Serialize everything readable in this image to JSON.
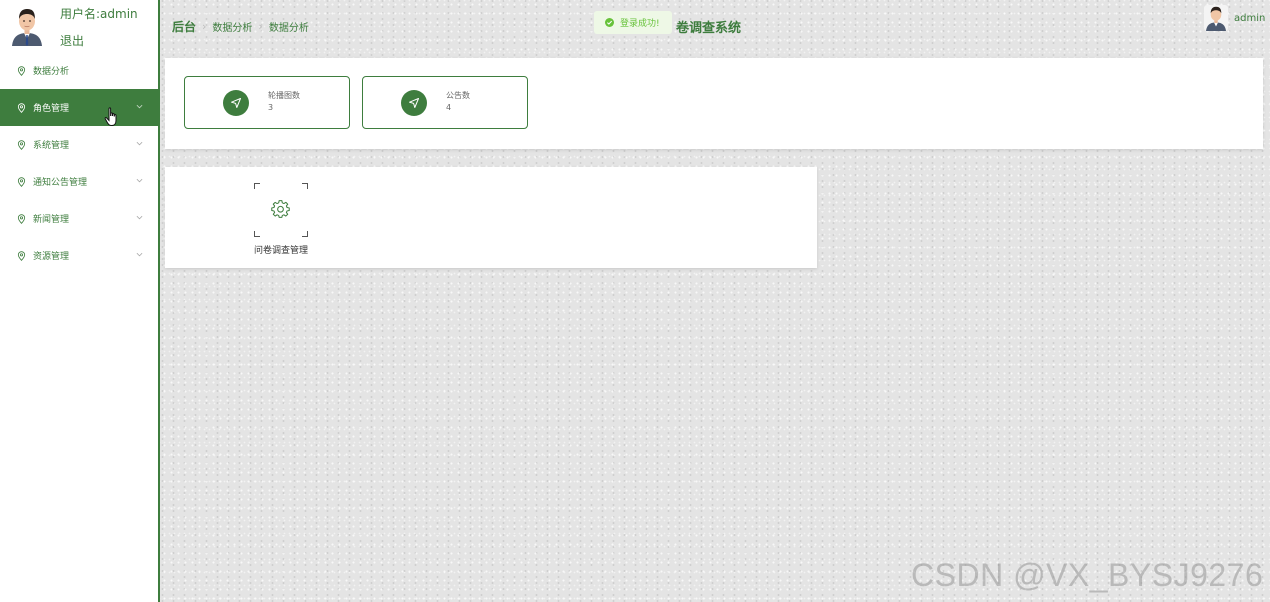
{
  "sidebar": {
    "user_label": "用户名:admin",
    "logout_label": "退出",
    "items": [
      {
        "label": "数据分析",
        "has_submenu": false,
        "active": false
      },
      {
        "label": "角色管理",
        "has_submenu": true,
        "active": true
      },
      {
        "label": "系统管理",
        "has_submenu": true,
        "active": false
      },
      {
        "label": "通知公告管理",
        "has_submenu": true,
        "active": false
      },
      {
        "label": "新闻管理",
        "has_submenu": true,
        "active": false
      },
      {
        "label": "资源管理",
        "has_submenu": true,
        "active": false
      }
    ]
  },
  "header": {
    "breadcrumb": [
      "后台",
      "数据分析",
      "数据分析"
    ],
    "toast": "登录成功!",
    "system_title": "卷调查系统",
    "admin_name": "admin"
  },
  "stats": [
    {
      "label": "轮播图数",
      "value": "3",
      "icon": "navigation-arrow-icon"
    },
    {
      "label": "公告数",
      "value": "4",
      "icon": "navigation-arrow-icon"
    }
  ],
  "shortcuts": [
    {
      "label": "问卷调查管理",
      "icon": "gear-icon"
    }
  ],
  "watermark": "CSDN @VX_BYSJ9276",
  "colors": {
    "primary": "#3e7d3e",
    "toast_bg": "#eef8e6",
    "toast_text": "#67c23a",
    "background": "#e4e4e4"
  }
}
